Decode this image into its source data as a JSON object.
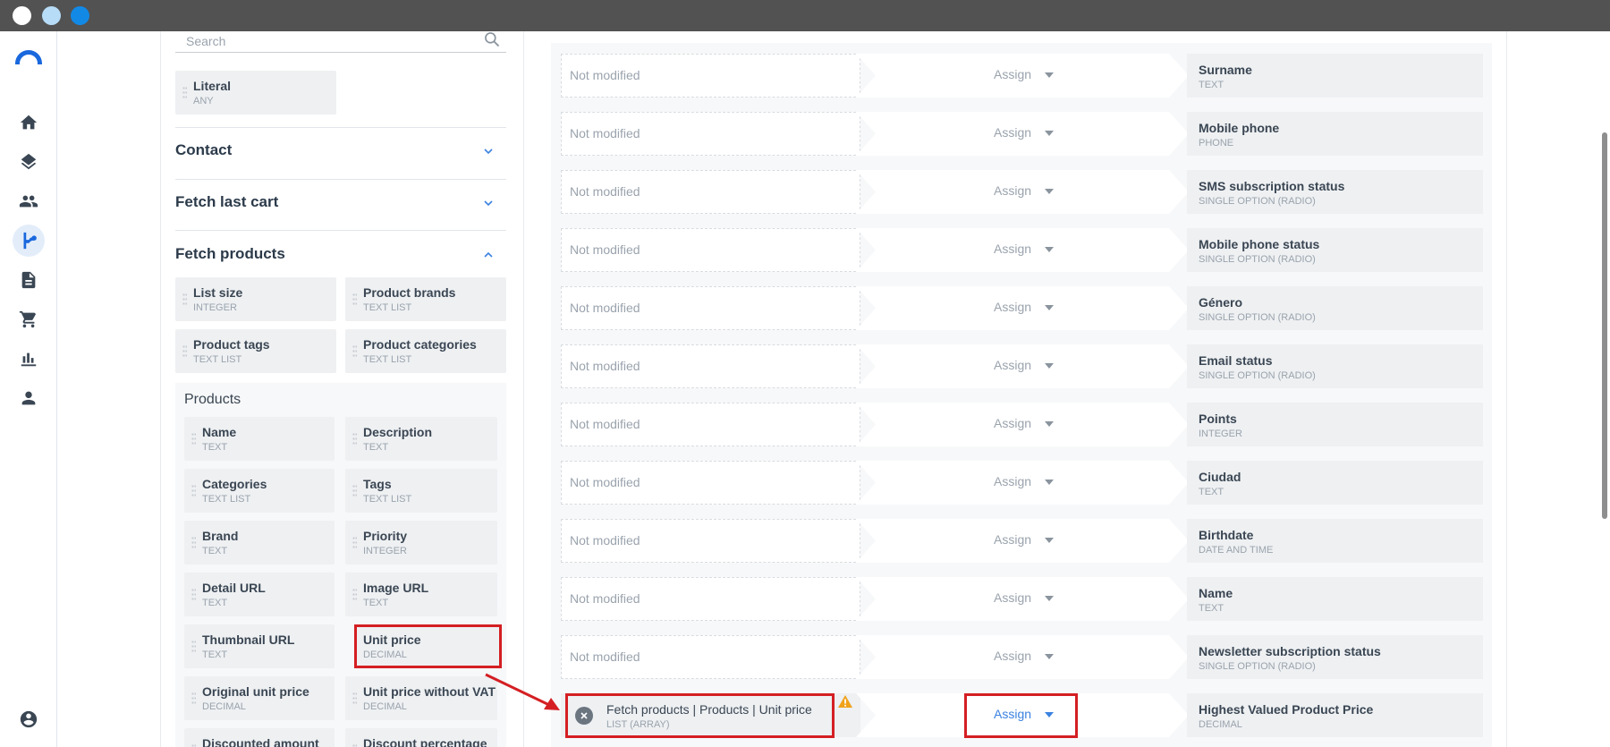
{
  "nav": {
    "items": [
      {
        "name": "home-icon"
      },
      {
        "name": "layers-icon"
      },
      {
        "name": "people-icon"
      },
      {
        "name": "flow-icon"
      },
      {
        "name": "document-icon"
      },
      {
        "name": "cart-icon"
      },
      {
        "name": "chart-icon"
      },
      {
        "name": "person-icon"
      },
      {
        "name": "account-icon"
      }
    ]
  },
  "search": {
    "placeholder": "Search"
  },
  "literal": {
    "name": "Literal",
    "type": "ANY"
  },
  "sections": {
    "contact": "Contact",
    "fetch_last_cart": "Fetch last cart",
    "fetch_products": "Fetch products"
  },
  "fetch_products_vars": [
    {
      "name": "List size",
      "type": "INTEGER"
    },
    {
      "name": "Product brands",
      "type": "TEXT LIST"
    },
    {
      "name": "Product tags",
      "type": "TEXT LIST"
    },
    {
      "name": "Product categories",
      "type": "TEXT LIST"
    }
  ],
  "products": {
    "title": "Products",
    "items": [
      {
        "name": "Name",
        "type": "TEXT"
      },
      {
        "name": "Description",
        "type": "TEXT"
      },
      {
        "name": "Categories",
        "type": "TEXT LIST"
      },
      {
        "name": "Tags",
        "type": "TEXT LIST"
      },
      {
        "name": "Brand",
        "type": "TEXT"
      },
      {
        "name": "Priority",
        "type": "INTEGER"
      },
      {
        "name": "Detail URL",
        "type": "TEXT"
      },
      {
        "name": "Image URL",
        "type": "TEXT"
      },
      {
        "name": "Thumbnail URL",
        "type": "TEXT"
      },
      {
        "name": "Unit price",
        "type": "DECIMAL"
      },
      {
        "name": "Original unit price",
        "type": "DECIMAL"
      },
      {
        "name": "Unit price without VAT",
        "type": "DECIMAL"
      },
      {
        "name": "Discounted amount",
        "type": ""
      },
      {
        "name": "Discount percentage",
        "type": ""
      }
    ]
  },
  "mapping": {
    "not_modified": "Not modified",
    "assign_label": "Assign",
    "rows": [
      {
        "target": "Surname",
        "type": "TEXT"
      },
      {
        "target": "Mobile phone",
        "type": "PHONE"
      },
      {
        "target": "SMS subscription status",
        "type": "SINGLE OPTION (RADIO)"
      },
      {
        "target": "Mobile phone status",
        "type": "SINGLE OPTION (RADIO)"
      },
      {
        "target": "Género",
        "type": "SINGLE OPTION (RADIO)"
      },
      {
        "target": "Email status",
        "type": "SINGLE OPTION (RADIO)"
      },
      {
        "target": "Points",
        "type": "INTEGER"
      },
      {
        "target": "Ciudad",
        "type": "TEXT"
      },
      {
        "target": "Birthdate",
        "type": "DATE AND TIME"
      },
      {
        "target": "Name",
        "type": "TEXT"
      },
      {
        "target": "Newsletter subscription status",
        "type": "SINGLE OPTION (RADIO)"
      }
    ],
    "assigned_row": {
      "source": "Fetch products | Products | Unit price",
      "source_type": "LIST (ARRAY)",
      "target": "Highest Valued Product Price",
      "type": "DECIMAL"
    }
  },
  "colors": {
    "accent": "#1a68dd",
    "highlight": "#d41f23",
    "warning": "#f0a21b"
  }
}
